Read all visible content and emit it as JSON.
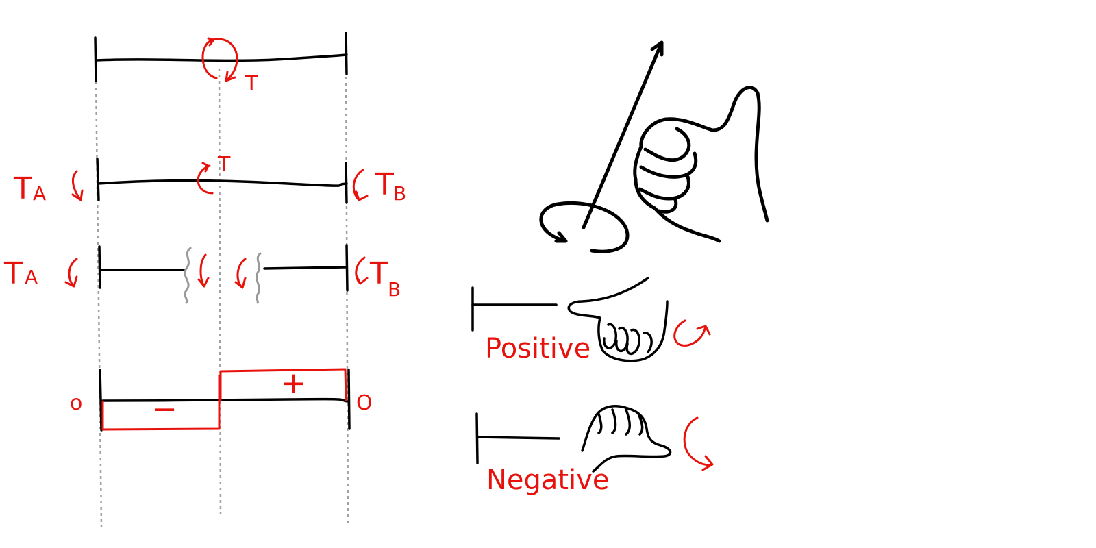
{
  "colors": {
    "ink": "#000000",
    "annotation": "#e8120c",
    "guide": "#a0a0a0",
    "cut": "#9a9a9a",
    "background": "#ffffff"
  },
  "beam_diagram": {
    "applied_torque": {
      "symbol": "T"
    },
    "reactions": {
      "left": {
        "main": "T",
        "sub": "A"
      },
      "right": {
        "main": "T",
        "sub": "B"
      },
      "internal": "T"
    },
    "free_body": {
      "left": {
        "main": "T",
        "sub": "A"
      },
      "right": {
        "main": "T",
        "sub": "B"
      }
    },
    "torque_diagram": {
      "left_end": "o",
      "right_end": "O",
      "left_segment_sign": "−",
      "right_segment_sign": "+"
    }
  },
  "right_hand_rule": {
    "positive_label": "Positive",
    "negative_label": "Negative"
  }
}
